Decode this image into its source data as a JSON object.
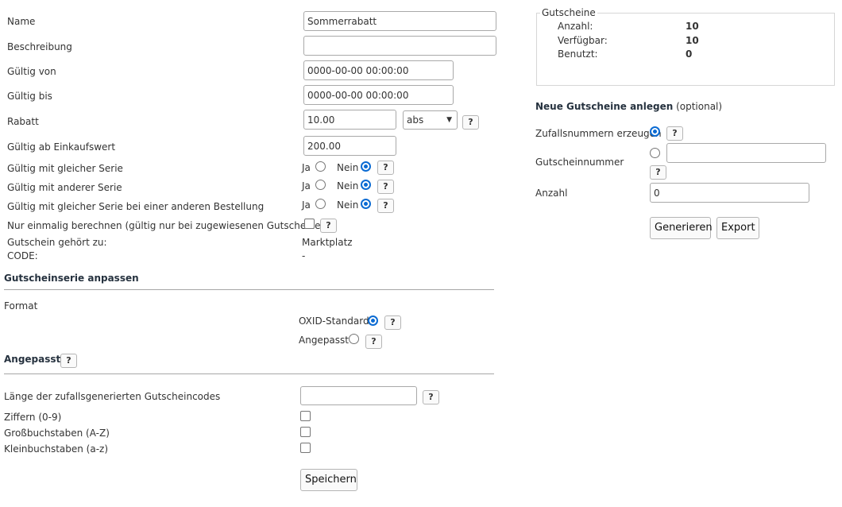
{
  "form": {
    "name_label": "Name",
    "name_value": "Sommerrabatt",
    "description_label": "Beschreibung",
    "description_value": "",
    "valid_from_label": "Gültig von",
    "valid_from_value": "0000-00-00 00:00:00",
    "valid_to_label": "Gültig bis",
    "valid_to_value": "0000-00-00 00:00:00",
    "discount_label": "Rabatt",
    "discount_value": "10.00",
    "discount_type_value": "abs",
    "min_value_label": "Gültig ab Einkaufswert",
    "min_value_value": "200.00",
    "same_series_label": "Gültig mit gleicher Serie",
    "other_series_label": "Gültig mit anderer Serie",
    "same_series_other_order_label": "Gültig mit gleicher Serie bei einer anderen Bestellung",
    "yes_label": "Ja",
    "no_label": "Nein",
    "calc_once_label": "Nur einmalig berechnen (gültig nur bei zugewiesenen Gutscheinen)",
    "belongs_to_label": "Gutschein gehört zu:",
    "belongs_to_value": "Marktplatz",
    "code_label": "CODE:",
    "code_value": "-",
    "help_glyph": "?"
  },
  "series": {
    "heading": "Gutscheinserie anpassen",
    "format_label": "Format",
    "standard_label": "OXID-Standard",
    "custom_label": "Angepasst"
  },
  "custom": {
    "heading": "Angepasst",
    "length_label": "Länge der zufallsgenerierten Gutscheincodes",
    "length_value": "",
    "digits_label": "Ziffern (0-9)",
    "upper_label": "Großbuchstaben (A-Z)",
    "lower_label": "Kleinbuchstaben (a-z)",
    "save_label": "Speichern"
  },
  "vouchers": {
    "legend": "Gutscheine",
    "count_label": "Anzahl:",
    "count_value": "10",
    "available_label": "Verfügbar:",
    "available_value": "10",
    "used_label": "Benutzt:",
    "used_value": "0"
  },
  "new_vouchers": {
    "heading": "Neue Gutscheine anlegen",
    "optional": "(optional)",
    "random_label": "Zufallsnummern erzeugen",
    "number_label": "Gutscheinnummer",
    "number_value": "",
    "amount_label": "Anzahl",
    "amount_value": "0",
    "generate_label": "Generieren",
    "export_label": "Export"
  },
  "colors": {
    "accent": "#0b6bd3",
    "heading": "#26323f",
    "text": "#333333",
    "border": "#a9a9a9"
  }
}
